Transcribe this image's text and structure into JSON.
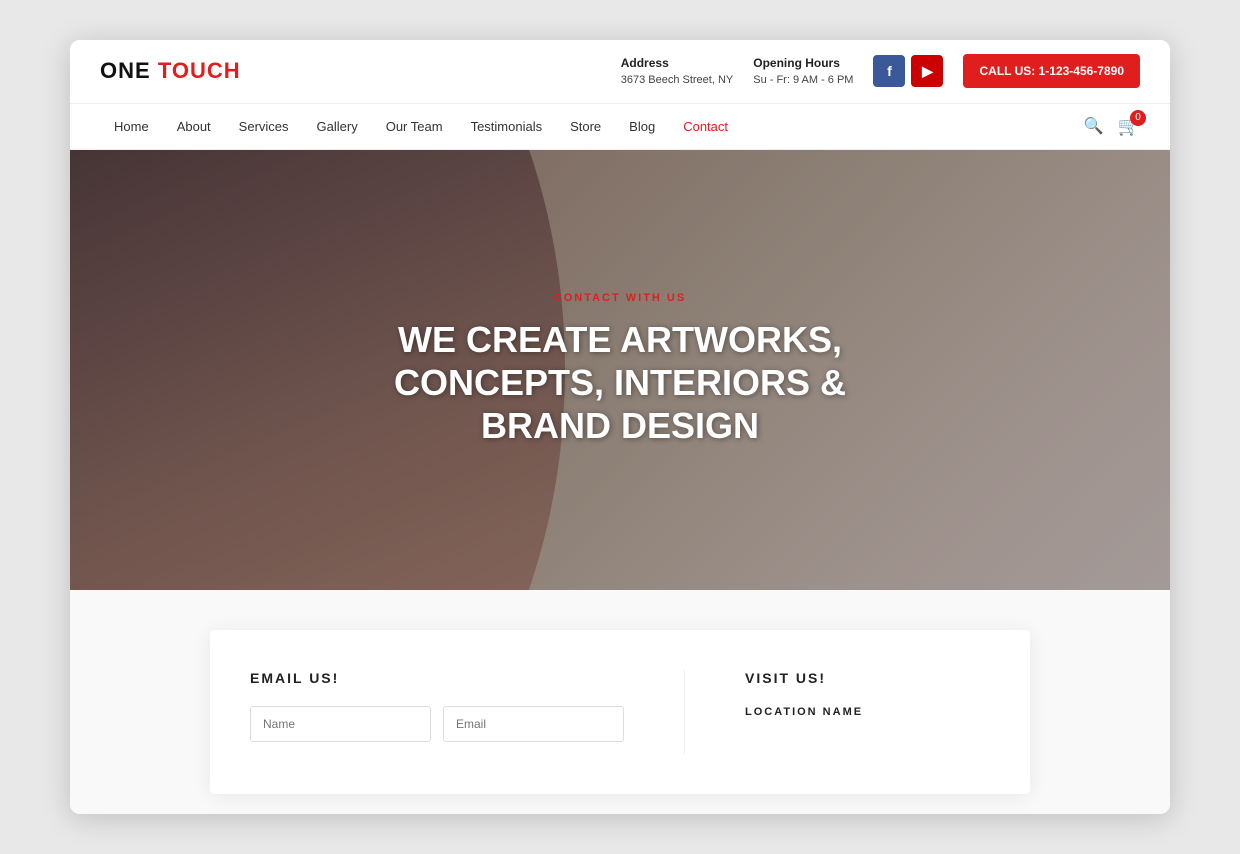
{
  "logo": {
    "one": "ONE",
    "touch": "TOUCH"
  },
  "topbar": {
    "address_label": "Address",
    "address_value": "3673 Beech Street, NY",
    "hours_label": "Opening Hours",
    "hours_value": "Su - Fr: 9 AM - 6 PM",
    "facebook_label": "f",
    "youtube_label": "▶",
    "call_btn": "CALL US: 1-123-456-7890"
  },
  "nav": {
    "links": [
      {
        "label": "Home",
        "href": "#",
        "active": false
      },
      {
        "label": "About",
        "href": "#",
        "active": false
      },
      {
        "label": "Services",
        "href": "#",
        "active": false
      },
      {
        "label": "Gallery",
        "href": "#",
        "active": false
      },
      {
        "label": "Our Team",
        "href": "#",
        "active": false
      },
      {
        "label": "Testimonials",
        "href": "#",
        "active": false
      },
      {
        "label": "Store",
        "href": "#",
        "active": false
      },
      {
        "label": "Blog",
        "href": "#",
        "active": false
      },
      {
        "label": "Contact",
        "href": "#",
        "active": true
      }
    ],
    "cart_count": "0"
  },
  "hero": {
    "subtitle": "CONTACT WITH US",
    "title": "WE CREATE ARTWORKS, CONCEPTS, INTERIORS & BRAND DESIGN"
  },
  "contact": {
    "email_section_title": "EMAIL US!",
    "visit_section_title": "VISIT US!",
    "location_label": "LOCATION NAME",
    "form": {
      "name_placeholder": "Name",
      "email_placeholder": "Email"
    }
  }
}
